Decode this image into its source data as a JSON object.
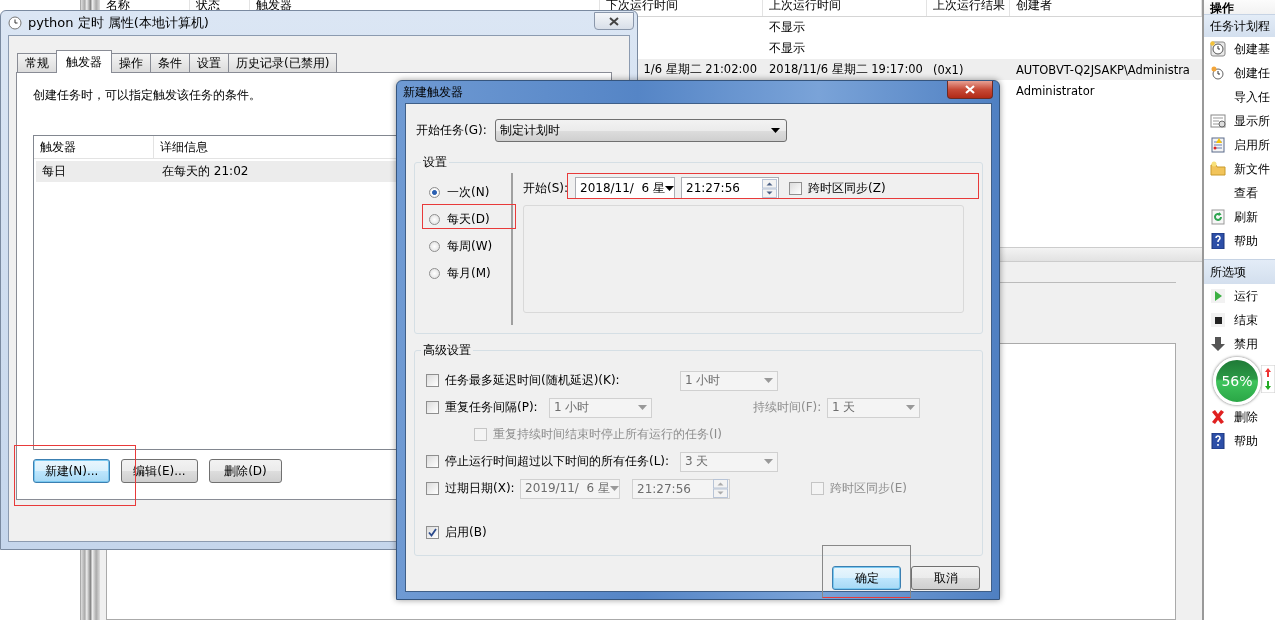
{
  "background_window": {
    "table": {
      "columns": [
        "名称",
        "状态",
        "触发器",
        "下次运行时间",
        "上次运行时间",
        "上次运行结果",
        "创建者"
      ],
      "rows": [
        {
          "selected": false,
          "last_run": "不显示"
        },
        {
          "selected": false,
          "last_run": "不显示"
        },
        {
          "selected": true,
          "next_run": "1/6 星期二 21:02:00",
          "last_run": "2018/11/6 星期二 19:17:00",
          "last_result": "(0x1)",
          "author": "AUTOBVT-Q2JSAKP\\Administra"
        },
        {
          "selected": false,
          "author": "Administrator"
        }
      ]
    },
    "actions_pane": {
      "header": "操作",
      "sections": [
        {
          "title": "任务计划程",
          "items": [
            "创建基",
            "创建任",
            "导入任",
            "显示所",
            "启用所",
            "新文件",
            "查看",
            "刷新",
            "帮助"
          ]
        },
        {
          "title": "所选项",
          "items": [
            "运行",
            "结束",
            "禁用",
            "删除",
            "帮助"
          ]
        }
      ]
    }
  },
  "perf_badge": {
    "reading": "56%"
  },
  "properties_dialog": {
    "title": "python 定时 属性(本地计算机)",
    "tabs": [
      {
        "label": "常规",
        "selected": false
      },
      {
        "label": "触发器",
        "selected": true
      },
      {
        "label": "操作",
        "selected": false
      },
      {
        "label": "条件",
        "selected": false
      },
      {
        "label": "设置",
        "selected": false
      },
      {
        "label": "历史记录(已禁用)",
        "selected": false
      }
    ],
    "description": "创建任务时，可以指定触发该任务的条件。",
    "trigger_list": {
      "columns": [
        "触发器",
        "详细信息"
      ],
      "rows": [
        {
          "selected": true,
          "cells": [
            "每日",
            "在每天的 21:02"
          ]
        }
      ]
    },
    "buttons": [
      {
        "label": "新建(N)...",
        "focused": true
      },
      {
        "label": "编辑(E)...",
        "focused": false
      },
      {
        "label": "删除(D)",
        "focused": false
      }
    ]
  },
  "trigger_dialog": {
    "title": "新建触发器",
    "start_task": {
      "label": "开始任务(G):",
      "value": "制定计划时"
    },
    "settings": {
      "title": "设置",
      "schedule_options": [
        {
          "label": "一次(N)",
          "selected": true
        },
        {
          "label": "每天(D)",
          "selected": false
        },
        {
          "label": "每周(W)",
          "selected": false
        },
        {
          "label": "每月(M)",
          "selected": false
        }
      ],
      "start": {
        "label": "开始(S):",
        "date": "2018/11/  6 星",
        "time": "21:27:56",
        "sync_label": "跨时区同步(Z)",
        "sync_checked": false
      }
    },
    "advanced": {
      "title": "高级设置",
      "delay": {
        "label": "任务最多延迟时间(随机延迟)(K):",
        "checked": false,
        "value": "1 小时",
        "disabled": true
      },
      "repeat": {
        "label": "重复任务间隔(P):",
        "checked": false,
        "value": "1 小时",
        "duration_label": "持续时间(F):",
        "duration_value": "1 天",
        "disabled": true
      },
      "stop_repeat": {
        "label": "重复持续时间结束时停止所有运行的任务(I)",
        "checked": false,
        "disabled": true
      },
      "stop_after": {
        "label": "停止运行时间超过以下时间的所有任务(L):",
        "checked": false,
        "value": "3 天",
        "disabled": true
      },
      "expire": {
        "label": "过期日期(X):",
        "checked": false,
        "date": "2019/11/  6 星",
        "time": "21:27:56",
        "sync_label": "跨时区同步(E)",
        "sync_checked": false,
        "disabled": true
      },
      "enabled": {
        "label": "启用(B)",
        "checked": true
      }
    },
    "buttons": [
      {
        "label": "确定",
        "focused": true
      },
      {
        "label": "取消",
        "focused": false
      }
    ]
  }
}
